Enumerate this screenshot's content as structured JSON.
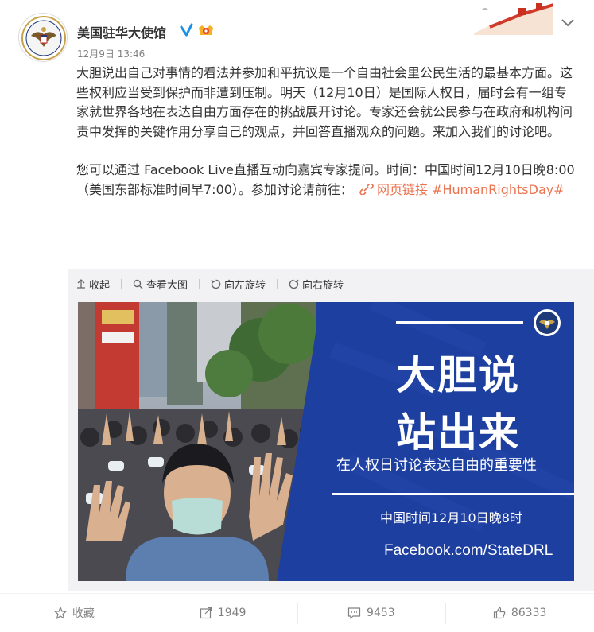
{
  "account": {
    "name": "美国驻华大使馆",
    "time": "12月9日 13:46"
  },
  "post": {
    "paragraph1": "大胆说出自己对事情的看法并参加和平抗议是一个自由社会里公民生活的最基本方面。这些权利应当受到保护而非遭到压制。明天（12月10日）是国际人权日，届时会有一组专家就世界各地在表达自由方面存在的挑战展开讨论。专家还会就公民参与在政府和机构问责中发挥的关键作用分享自己的观点，并回答直播观众的问题。来加入我们的讨论吧。",
    "paragraph2_text": "您可以通过 Facebook Live直播互动向嘉宾专家提问。时间：中国时间12月10日晚8:00（美国东部标准时间早7:00）。参加讨论请前往：",
    "weblink": "网页链接",
    "hashtag": "#HumanRightsDay#"
  },
  "media_tools": {
    "collapse": "收起",
    "view_large": "查看大图",
    "rotate_left": "向左旋转",
    "rotate_right": "向右旋转"
  },
  "poster": {
    "title_line1": "大胆说",
    "title_line2": "站出来",
    "subtitle": "在人权日讨论表达自由的重要性",
    "time": "中国时间12月10日晚8时",
    "url": "Facebook.com/StateDRL"
  },
  "footer": {
    "favorite": "收藏",
    "forward_count": "1949",
    "comment_count": "9453",
    "like_count": "86333"
  },
  "colors": {
    "link": "#eb7350",
    "poster_blue": "#1d3fa0",
    "verified": "#1a8fe6"
  }
}
